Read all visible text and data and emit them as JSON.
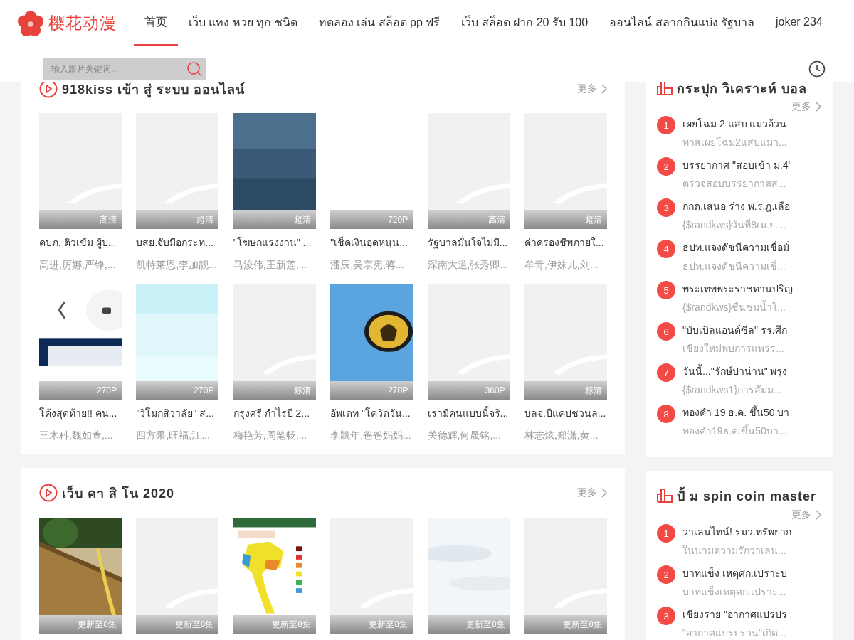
{
  "logo": {
    "text": "樱花动漫"
  },
  "nav": [
    {
      "label": "首页",
      "selected": true
    },
    {
      "label": "เว็บ แทง หวย ทุก ชนิด",
      "selected": false
    },
    {
      "label": "ทดลอง เล่น สล็อต pp ฟรี",
      "selected": false
    },
    {
      "label": "เว็บ สล็อต ฝาก 20 รับ 100",
      "selected": false
    },
    {
      "label": "ออนไลน์ สลากกินแบ่ง รัฐบาล",
      "selected": false
    },
    {
      "label": "joker 234",
      "selected": false
    }
  ],
  "search": {
    "placeholder": "输入影片关键词..."
  },
  "sections": [
    {
      "title": "918kiss เข้า สู่ ระบบ ออนไลน์",
      "more": "更多",
      "cards": [
        {
          "kind": "placeholder",
          "badge": "高清",
          "title": "คปภ. ติวเข้ม ผู้ป...",
          "cast": "高进,厉娜,严铮,..."
        },
        {
          "kind": "placeholder",
          "badge": "超清",
          "title": "บสย.จับมือกระท...",
          "cast": "凯特莱恩,李加靓..."
        },
        {
          "kind": "blue",
          "badge": "超清",
          "title": "\"โฆษกแรงงาน\" ...",
          "cast": "马浚伟,王新莲,..."
        },
        {
          "kind": "blank",
          "badge": "720P",
          "title": "\"เช็คเงินอุดหนุน...",
          "cast": "潘辰,吴宗宪,蒋..."
        },
        {
          "kind": "placeholder",
          "badge": "高清",
          "title": "รัฐบาลมั่นใจไม่มี...",
          "cast": "深南大道,张秀卿..."
        },
        {
          "kind": "placeholder",
          "badge": "超清",
          "title": "ค่าครองชีพภายใ...",
          "cast": "牟青,伊妹儿,刘..."
        },
        {
          "kind": "phone",
          "badge": "270P",
          "title": "โค้งสุดท้าย!! คน...",
          "cast": "三木科,魏如萱,..."
        },
        {
          "kind": "cyan",
          "badge": "270P",
          "title": "\"วิโมกสิวาลัย\" ส...",
          "cast": "四方果,旺福,江..."
        },
        {
          "kind": "placeholder",
          "badge": "标清",
          "title": "กรุงศรี กำไรปี 2...",
          "cast": "梅艳芳,周笔畅,..."
        },
        {
          "kind": "emblem",
          "badge": "270P",
          "title": "อัพเดท \"โควิดวัน...",
          "cast": "李凯年,爸爸妈妈..."
        },
        {
          "kind": "placeholder",
          "badge": "360P",
          "title": "เรามีคนแบบนี้จริ...",
          "cast": "关德辉,何晟铭,..."
        },
        {
          "kind": "placeholder",
          "badge": "标清",
          "title": "บลจ.ปีแคปชวนล...",
          "cast": "林志炫,郑潇,黄..."
        }
      ]
    },
    {
      "title": "เว็บ คา สิ โน 2020",
      "more": "更多",
      "cards": [
        {
          "badge": "更新至8集"
        },
        {
          "kind": "placeholder",
          "badge": "更新至8集"
        },
        {
          "kind": "map",
          "badge": "更新至8集"
        },
        {
          "kind": "placeholder",
          "badge": "更新至8集"
        },
        {
          "kind": "sky",
          "badge": "更新至8集"
        },
        {
          "kind": "placeholder",
          "badge": "更新至8集"
        }
      ]
    }
  ],
  "rankings": [
    {
      "title": "กระปุก วิเคราะห์ บอล",
      "more": "更多",
      "items": [
        {
          "rank": "1",
          "title": "เผยโฉม 2 แสบ แมวอ้วน",
          "sub": "ทาสเผยโฉม2แสบแมว..."
        },
        {
          "rank": "2",
          "title": "บรรยากาศ \"สอบเข้า ม.4'",
          "sub": "ตรวจสอบบรรยากาศส..."
        },
        {
          "rank": "3",
          "title": "กกต.เสนอ ร่าง พ.ร.ฎ.เลือ",
          "sub": "{$randkws}วันที่8เม.ย...."
        },
        {
          "rank": "4",
          "title": "ธปท.แจงดัชนีความเชื่อมั่",
          "sub": "ธปท.แจงดัชนีความเชื่..."
        },
        {
          "rank": "5",
          "title": "พระเทพพระราชทานปริญ",
          "sub": "{$randkws}ชื่นชมน้ำใ..."
        },
        {
          "rank": "6",
          "title": "\"บับเบิลแอนด์ซีล\" รร.ศึก",
          "sub": "เชียงใหม่พบการแพร่ร..."
        },
        {
          "rank": "7",
          "title": "วันนี้...\"รักษ์ป่าน่าน\" พรุ่ง",
          "sub": "{$randkws1}การสัมม..."
        },
        {
          "rank": "8",
          "title": "ทองคำ 19 ธ.ค. ขึ้น50 บา",
          "sub": "ทองคำ19ธ.ค.ขึ้น50บา..."
        }
      ]
    },
    {
      "title": "ปั้ ม spin coin master",
      "more": "更多",
      "items": [
        {
          "rank": "1",
          "title": "วาเลนไทน์! รมว.ทรัพยาก",
          "sub": "ในนามความรักวาเลน..."
        },
        {
          "rank": "2",
          "title": "บาทแข็ง เหตุศก.เปราะบ",
          "sub": "บาทแข็งเหตุศก.เปราะ..."
        },
        {
          "rank": "3",
          "title": "เชียงราย \"อากาศแปรปร",
          "sub": "\"อากาศแปรปรวน\"เกิด..."
        }
      ]
    }
  ]
}
